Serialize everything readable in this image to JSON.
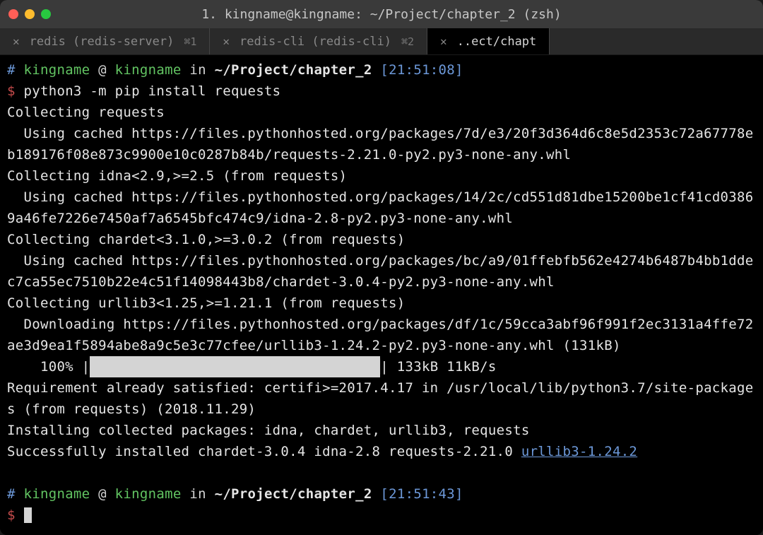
{
  "window": {
    "title": "1. kingname@kingname: ~/Project/chapter_2 (zsh)"
  },
  "tabs": [
    {
      "label": "redis (redis-server)",
      "shortcut": "⌘1",
      "active": false
    },
    {
      "label": "redis-cli (redis-cli)",
      "shortcut": "⌘2",
      "active": false
    },
    {
      "label": "..ect/chapt",
      "shortcut": "",
      "active": true
    }
  ],
  "prompt1": {
    "hash": "#",
    "user": "kingname",
    "at": "@",
    "host": "kingname",
    "in_word": "in",
    "path": "~/Project/chapter_2",
    "time": "[21:51:08]",
    "dollar": "$",
    "command": "python3 -m pip install requests"
  },
  "output": {
    "l01": "Collecting requests",
    "l02": "  Using cached https://files.pythonhosted.org/packages/7d/e3/20f3d364d6c8e5d2353c72a67778eb189176f08e873c9900e10c0287b84b/requests-2.21.0-py2.py3-none-any.whl",
    "l03": "Collecting idna<2.9,>=2.5 (from requests)",
    "l04": "  Using cached https://files.pythonhosted.org/packages/14/2c/cd551d81dbe15200be1cf41cd03869a46fe7226e7450af7a6545bfc474c9/idna-2.8-py2.py3-none-any.whl",
    "l05": "Collecting chardet<3.1.0,>=3.0.2 (from requests)",
    "l06": "  Using cached https://files.pythonhosted.org/packages/bc/a9/01ffebfb562e4274b6487b4bb1ddec7ca55ec7510b22e4c51f14098443b8/chardet-3.0.4-py2.py3-none-any.whl",
    "l07": "Collecting urllib3<1.25,>=1.21.1 (from requests)",
    "l08": "  Downloading https://files.pythonhosted.org/packages/df/1c/59cca3abf96f991f2ec3131a4ffe72ae3d9ea1f5894abe8a9c5e3c77cfee/urllib3-1.24.2-py2.py3-none-any.whl (131kB)",
    "progress_pct": "    100% |",
    "progress_fill": "███████████████████████████████████",
    "progress_tail": "| 133kB 11kB/s",
    "l10": "Requirement already satisfied: certifi>=2017.4.17 in /usr/local/lib/python3.7/site-packages (from requests) (2018.11.29)",
    "l11": "Installing collected packages: idna, chardet, urllib3, requests",
    "l12_prefix": "Successfully installed chardet-3.0.4 idna-2.8 requests-2.21.0 ",
    "l12_link": "urllib3-1.24.2"
  },
  "prompt2": {
    "hash": "#",
    "user": "kingname",
    "at": "@",
    "host": "kingname",
    "in_word": "in",
    "path": "~/Project/chapter_2",
    "time": "[21:51:43]",
    "dollar": "$"
  }
}
